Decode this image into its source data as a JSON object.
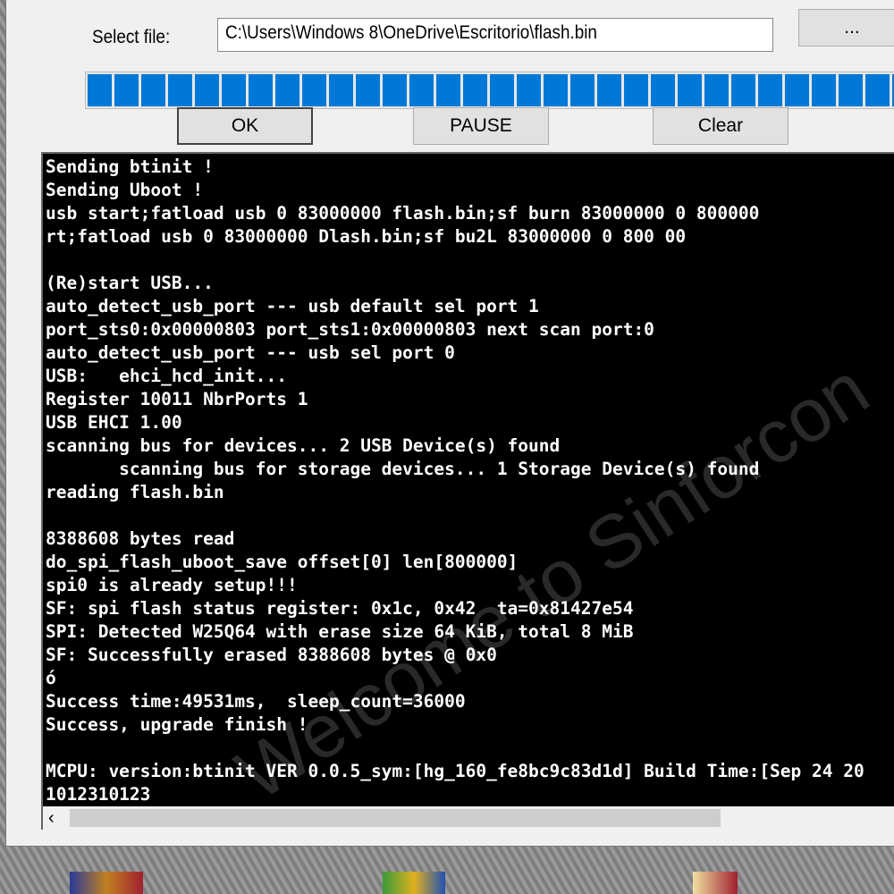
{
  "form": {
    "select_file_label": "Select file:",
    "file_path": "C:\\Users\\Windows 8\\OneDrive\\Escritorio\\flash.bin",
    "browse_label": "..."
  },
  "progress": {
    "percent": 100,
    "color": "#0078d7"
  },
  "buttons": {
    "ok": "OK",
    "pause": "PAUSE",
    "clear": "Clear"
  },
  "console": {
    "watermark": "Welcome to Sinforcon",
    "lines": [
      "Sending btinit !",
      "Sending Uboot !",
      "usb start;fatload usb 0 83000000 flash.bin;sf burn 83000000 0 800000",
      "rt;fatload usb 0 83000000 Dlash.bin;sf bu2L 83000000 0 800 00",
      "",
      "(Re)start USB...",
      "auto_detect_usb_port --- usb default sel port 1",
      "port_sts0:0x00000803 port_sts1:0x00000803 next scan port:0",
      "auto_detect_usb_port --- usb sel port 0",
      "USB:   ehci_hcd_init...",
      "Register 10011 NbrPorts 1",
      "USB EHCI 1.00",
      "scanning bus for devices... 2 USB Device(s) found",
      "       scanning bus for storage devices... 1 Storage Device(s) found",
      "reading flash.bin",
      "",
      "8388608 bytes read",
      "do_spi_flash_uboot_save offset[0] len[800000]",
      "spi0 is already setup!!!",
      "SF: spi flash status register: 0x1c, 0x42  ta=0x81427e54",
      "SPI: Detected W25Q64 with erase size 64 KiB, total 8 MiB",
      "SF: Successfully erased 8388608 bytes @ 0x0",
      "ó",
      "Success time:49531ms,  sleep_count=36000",
      "Success, upgrade finish !",
      "",
      "MCPU: version:btinit VER 0.0.5_sym:[hg_160_fe8bc9c83d1d] Build Time:[Sep 24 20",
      "1012310123"
    ]
  },
  "scrollbar": {
    "left_arrow": "‹"
  }
}
